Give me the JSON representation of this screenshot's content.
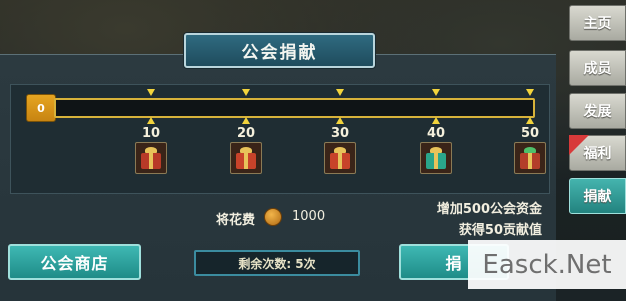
{
  "title": "公会捐献",
  "progress": {
    "current_label": "0",
    "fill_fraction": 0,
    "milestones": [
      {
        "value": "10",
        "gift_color": "#b83a28",
        "gift_name": "red-gift-icon"
      },
      {
        "value": "20",
        "gift_color": "#c8432a",
        "gift_name": "red-gift-icon"
      },
      {
        "value": "30",
        "gift_color": "#c8432a",
        "gift_name": "red-gift-icon"
      },
      {
        "value": "40",
        "gift_color": "#2aa58a",
        "gift_name": "teal-gift-icon"
      },
      {
        "value": "50",
        "gift_color": "#b33d2a",
        "gift_name": "green-bow-gift-icon"
      }
    ]
  },
  "cost": {
    "label": "将花费",
    "value": "1000",
    "icon": "coin-icon"
  },
  "rewards": {
    "line1": "增加500公会资金",
    "line2": "获得50贡献值"
  },
  "buttons": {
    "shop": "公会商店",
    "donate_partial": "捐"
  },
  "remaining": {
    "label": "剩余次数:",
    "value": "5次"
  },
  "side_tabs": [
    {
      "label": "主页",
      "active": false
    },
    {
      "label": "成员",
      "active": false
    },
    {
      "label": "发展",
      "active": false
    },
    {
      "label": "福利",
      "active": false,
      "badge": true
    },
    {
      "label": "捐献",
      "active": true
    }
  ],
  "watermark": "Easck.Net"
}
